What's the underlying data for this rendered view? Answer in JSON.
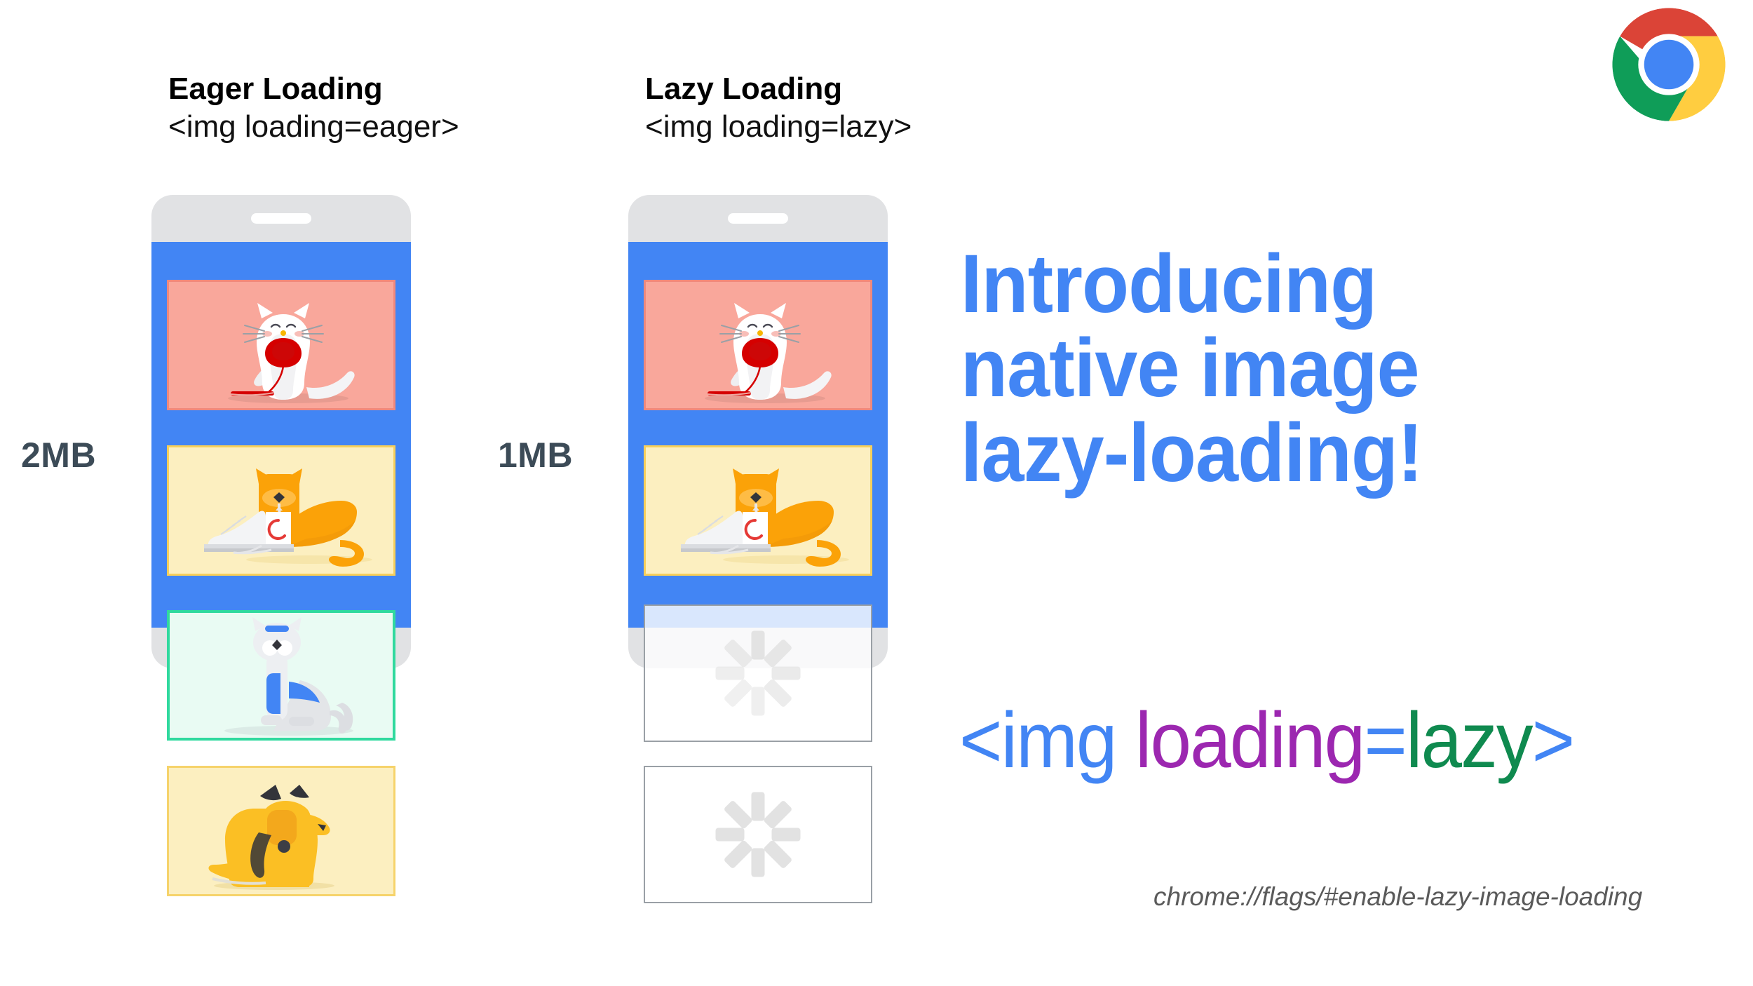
{
  "slide": {
    "background_color": "#ffffff",
    "brand_blue": "#4285F4",
    "label_color": "#3C4B57"
  },
  "columns": [
    {
      "id": "eager",
      "title": "Eager Loading",
      "code": "<img loading=eager>",
      "size_label": "2MB",
      "phone": {
        "bezel_color": "#E1E2E4",
        "screen_color": "#4285F4",
        "cards": [
          {
            "name": "white-cat-with-yarn",
            "background": "#F9A79B",
            "border": "#F0897C",
            "state": "loaded"
          },
          {
            "name": "orange-cat-with-sneaker",
            "background": "#FCEFC0",
            "border": "#F6CF5B",
            "state": "loaded"
          },
          {
            "name": "blue-gray-cat",
            "background": "#E9FBF3",
            "border": "#30D99E",
            "state": "loaded"
          },
          {
            "name": "orange-dog",
            "background": "#FCEFC0",
            "border": "#F6D36B",
            "state": "loaded"
          }
        ]
      }
    },
    {
      "id": "lazy",
      "title": "Lazy Loading",
      "code": "<img loading=lazy>",
      "size_label": "1MB",
      "phone": {
        "bezel_color": "#E1E2E4",
        "screen_color": "#4285F4",
        "cards": [
          {
            "name": "white-cat-with-yarn",
            "background": "#F9A79B",
            "border": "#F0897C",
            "state": "loaded"
          },
          {
            "name": "orange-cat-with-sneaker",
            "background": "#FCEFC0",
            "border": "#F6CF5B",
            "state": "loaded"
          },
          {
            "name": "placeholder-spinner-1",
            "background": "#FFFFFF",
            "border": "#9AA0A6",
            "state": "loading"
          },
          {
            "name": "placeholder-spinner-2",
            "background": "#FFFFFF",
            "border": "#9AA0A6",
            "state": "loading"
          }
        ]
      }
    }
  ],
  "headline": {
    "line1": "Introducing",
    "line2": "native image",
    "line3": "lazy-loading!",
    "color": "#4285F4"
  },
  "code_snippet": {
    "open_tag": "<img",
    "attribute": "loading",
    "equals": "=",
    "value": "lazy",
    "close_tag": ">",
    "tag_color": "#4285F4",
    "attribute_color": "#9C27B0",
    "value_color": "#0F8A4F"
  },
  "flag_url": "chrome://flags/#enable-lazy-image-loading",
  "logo": {
    "name": "chrome-logo",
    "red": "#DB4437",
    "yellow": "#FFCD40",
    "green": "#0F9D58",
    "blue": "#4285F4",
    "white_ring": "#FFFFFF"
  }
}
